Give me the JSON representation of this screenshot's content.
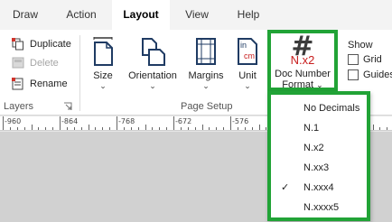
{
  "tabs": [
    {
      "label": "Draw",
      "active": false
    },
    {
      "label": "Action",
      "active": false
    },
    {
      "label": "Layout",
      "active": true
    },
    {
      "label": "View",
      "active": false
    },
    {
      "label": "Help",
      "active": false
    }
  ],
  "layers_group": {
    "commands": [
      {
        "label": "Duplicate",
        "icon": "duplicate-icon",
        "enabled": true
      },
      {
        "label": "Delete",
        "icon": "delete-icon",
        "enabled": false
      },
      {
        "label": "Rename",
        "icon": "rename-icon",
        "enabled": true
      }
    ],
    "label": "Layers"
  },
  "page_setup_group": {
    "buttons": [
      {
        "label": "Size",
        "icon": "page-size-icon"
      },
      {
        "label": "Orientation",
        "icon": "orientation-icon"
      },
      {
        "label": "Margins",
        "icon": "margins-icon"
      },
      {
        "label": "Unit",
        "icon": "unit-icon",
        "icon_text_top": "in",
        "icon_text_bottom": "cm"
      }
    ],
    "label": "Page Setup"
  },
  "doc_number": {
    "icon_glyph": "#",
    "format_preview": "N.x2",
    "label_line1": "Doc Number",
    "label_line2": "Format",
    "highlight_color": "#21a336"
  },
  "show_group": {
    "title": "Show",
    "checkboxes": [
      {
        "label": "Grid",
        "checked": false
      },
      {
        "label": "Guides",
        "checked": false
      }
    ]
  },
  "ruler": {
    "labels": [
      "-960",
      "-864",
      "-768",
      "-672",
      "-576",
      "-480",
      "-384"
    ]
  },
  "dropdown": {
    "items": [
      {
        "label": "No Decimals",
        "selected": false
      },
      {
        "label": "N.1",
        "selected": false
      },
      {
        "label": "N.x2",
        "selected": false
      },
      {
        "label": "N.xx3",
        "selected": false
      },
      {
        "label": "N.xxx4",
        "selected": true
      },
      {
        "label": "N.xxxx5",
        "selected": false
      }
    ],
    "check_glyph": "✓"
  }
}
